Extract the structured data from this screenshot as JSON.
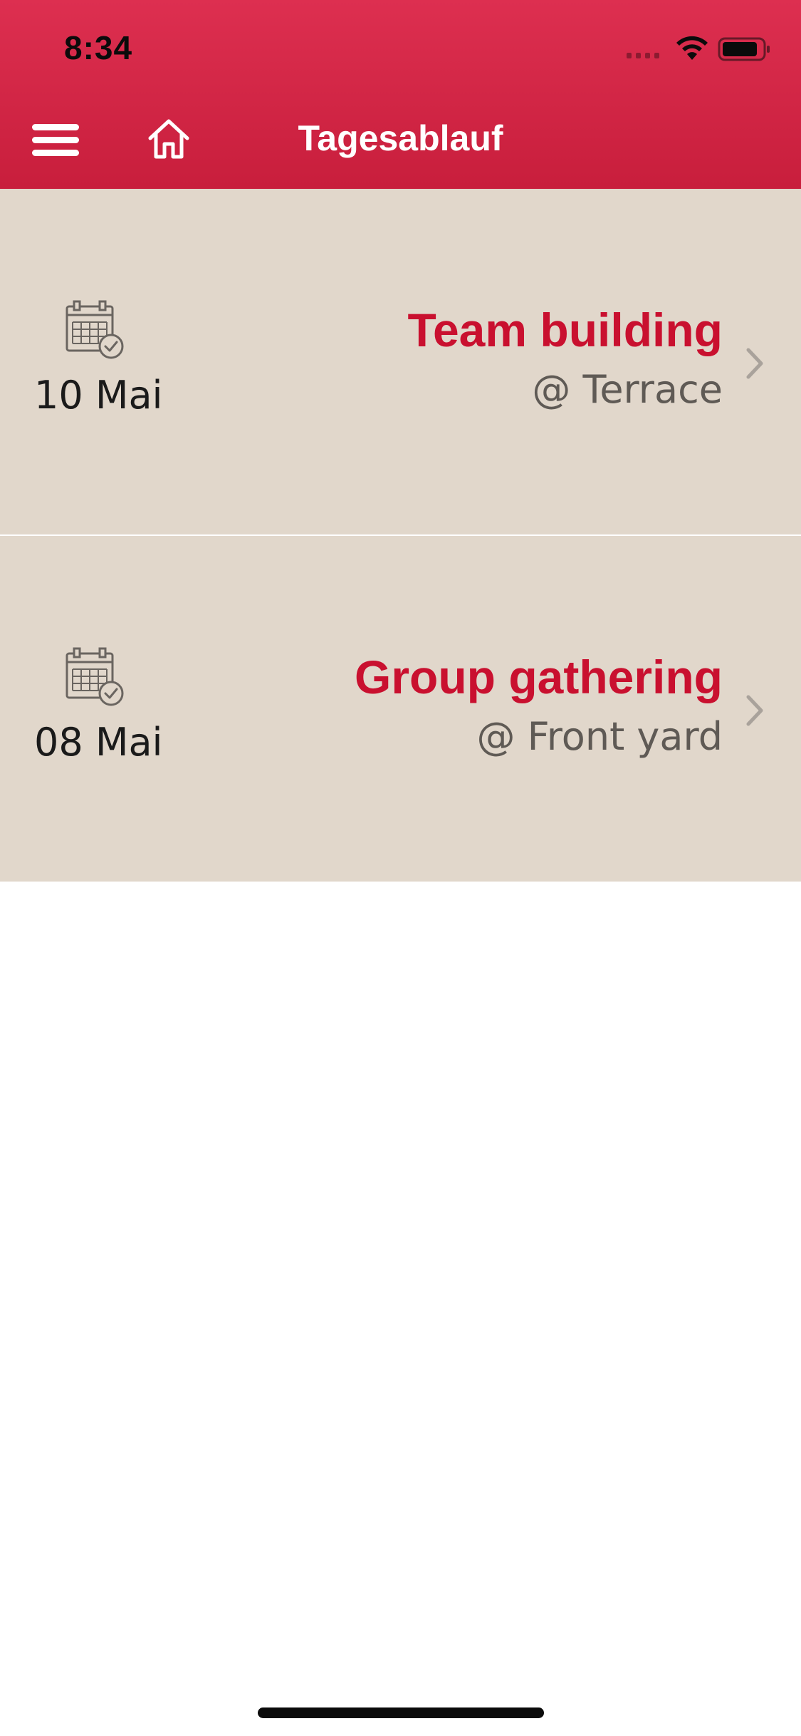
{
  "status_bar": {
    "time": "8:34",
    "wifi_icon": "wifi-icon",
    "battery_icon": "battery-icon"
  },
  "header": {
    "title": "Tagesablauf",
    "menu_icon": "hamburger-menu-icon",
    "home_icon": "home-icon",
    "background_color": "#cc2141"
  },
  "events": [
    {
      "date": "10 Mai",
      "title": "Team building",
      "location": "@ Terrace",
      "icon": "calendar-check-icon"
    },
    {
      "date": "08 Mai",
      "title": "Group gathering",
      "location": "@ Front yard",
      "icon": "calendar-check-icon"
    }
  ],
  "colors": {
    "accent": "#c9102f",
    "row_background": "#e1d7cb",
    "location_text": "#5f5a55"
  }
}
